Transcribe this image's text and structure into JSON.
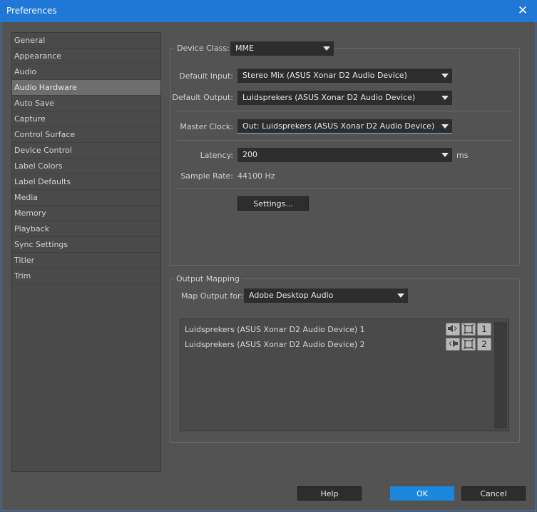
{
  "window": {
    "title": "Preferences",
    "close_glyph": "✕"
  },
  "sidebar": {
    "items": [
      {
        "label": "General"
      },
      {
        "label": "Appearance"
      },
      {
        "label": "Audio"
      },
      {
        "label": "Audio Hardware",
        "selected": true
      },
      {
        "label": "Auto Save"
      },
      {
        "label": "Capture"
      },
      {
        "label": "Control Surface"
      },
      {
        "label": "Device Control"
      },
      {
        "label": "Label Colors"
      },
      {
        "label": "Label Defaults"
      },
      {
        "label": "Media"
      },
      {
        "label": "Memory"
      },
      {
        "label": "Playback"
      },
      {
        "label": "Sync Settings"
      },
      {
        "label": "Titler"
      },
      {
        "label": "Trim"
      }
    ]
  },
  "device": {
    "class_label": "Device Class:",
    "class_value": "MME",
    "input_label": "Default Input:",
    "input_value": "Stereo Mix (ASUS Xonar D2 Audio Device)",
    "output_label": "Default Output:",
    "output_value": "Luidsprekers (ASUS Xonar D2 Audio Device)",
    "clock_label": "Master Clock:",
    "clock_value": "Out: Luidsprekers (ASUS Xonar D2 Audio Device)",
    "latency_label": "Latency:",
    "latency_value": "200",
    "latency_unit": "ms",
    "sample_rate_label": "Sample Rate:",
    "sample_rate_value": "44100 Hz",
    "settings_label": "Settings..."
  },
  "output_mapping": {
    "group_label": "Output Mapping",
    "map_label": "Map Output for:",
    "map_value": "Adobe Desktop Audio",
    "rows": [
      {
        "label": "Luidsprekers (ASUS Xonar D2 Audio Device) 1",
        "channel": "1",
        "speaker_icon": "speaker-left-icon"
      },
      {
        "label": "Luidsprekers (ASUS Xonar D2 Audio Device) 2",
        "channel": "2",
        "speaker_icon": "speaker-right-icon"
      }
    ]
  },
  "footer": {
    "help_label": "Help",
    "ok_label": "OK",
    "cancel_label": "Cancel"
  },
  "colors": {
    "titlebar": "#1f77d6",
    "accent": "#1a87dd",
    "panel": "#535353"
  }
}
